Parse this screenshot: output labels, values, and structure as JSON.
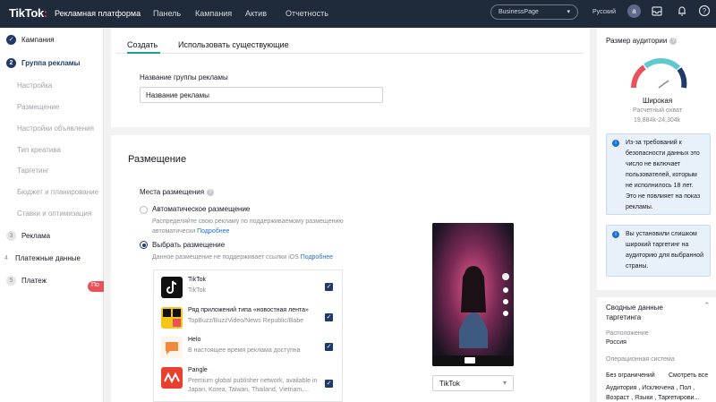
{
  "topbar": {
    "logo": "TikTok",
    "platform": "Рекламная платформа",
    "nav": [
      "Панель",
      "Кампания",
      "Актив",
      "Отчетность"
    ],
    "business_select": "BusinessPage",
    "language": "Русский",
    "avatar_letter": "a"
  },
  "sidebar": {
    "steps": [
      {
        "num": "✓",
        "label": "Кампания"
      },
      {
        "num": "2",
        "label": "Группа рекламы"
      },
      {
        "num": "3",
        "label": "Реклама"
      },
      {
        "num": "4",
        "label": "Платежные данные"
      },
      {
        "num": "5",
        "label": "Платеж"
      }
    ],
    "substeps": [
      "Настройка",
      "Размещение",
      "Настройки объявления",
      "Тип креатива",
      "Таргетинг",
      "Бюджет и планирование",
      "Ставки и оптимизация"
    ],
    "pill": "По"
  },
  "main": {
    "tabs": [
      "Создать",
      "Использовать существующие"
    ],
    "adgroup_label": "Название группы рекламы",
    "adgroup_value": "Название рекламы",
    "placement_heading": "Размещение",
    "placement_label": "Места размещения",
    "auto_label": "Автоматическое размещение",
    "auto_desc": "Распределяйте свою рекламу по поддерживаемому размещению",
    "auto_desc2": "автоматически",
    "more": "Подробнее",
    "manual_label": "Выбрать размещение",
    "manual_desc": "Данное размещение не поддерживает ссылки iOS",
    "placements": [
      {
        "name": "TikTok",
        "desc": "TikTok"
      },
      {
        "name": "Ряд приложений типа «новостная лента»",
        "desc": "TopBuzz/BuzzVideo/News Republic/Babe"
      },
      {
        "name": "Helo",
        "desc": "В настоящее время реклама доступна"
      },
      {
        "name": "Pangle",
        "desc": "Premium global publisher network, available in",
        "desc2": "Japan, Korea, Taiwan, Thailand, Vietnam,..."
      }
    ],
    "preview_select": "TikTok"
  },
  "right": {
    "audience_title": "Размер аудитории",
    "gauge_label": "Широкая",
    "reach_label": "Расчетный охват",
    "reach_value": "19,884k-24,304k",
    "info1": "Из-за требований к безопасности данных это число не включает пользователей, которым не исполнилось 18 лет. Это не повлияет на показ рекламы.",
    "info2": "Вы установили слишком широкий таргетинг на аудиторию для выбранной страны.",
    "summary_title": "Сводные данные таргетинга",
    "location_label": "Расположение",
    "location_value": "Россия",
    "os_label": "Операционная система",
    "no_limits": "Без ограничений",
    "see_all": "Смотреть все",
    "line1": "Аудитория , Исключена , Пол ,",
    "line2": "Возраст , Языки , Таргетирови..."
  }
}
